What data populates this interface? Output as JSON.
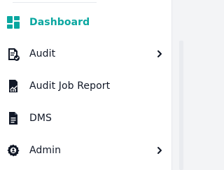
{
  "sidebar": {
    "items": [
      {
        "label": "Dashboard",
        "icon": "dashboard-grid-icon",
        "active": true,
        "has_submenu": false
      },
      {
        "label": "Audit",
        "icon": "audit-report-icon",
        "active": false,
        "has_submenu": true
      },
      {
        "label": "Audit Job Report",
        "icon": "job-report-icon",
        "active": false,
        "has_submenu": false
      },
      {
        "label": "DMS",
        "icon": "document-icon",
        "active": false,
        "has_submenu": false
      },
      {
        "label": "Admin",
        "icon": "admin-gear-icon",
        "active": false,
        "has_submenu": true
      }
    ],
    "accent_color": "#0aa7a0",
    "text_color": "#111827"
  }
}
